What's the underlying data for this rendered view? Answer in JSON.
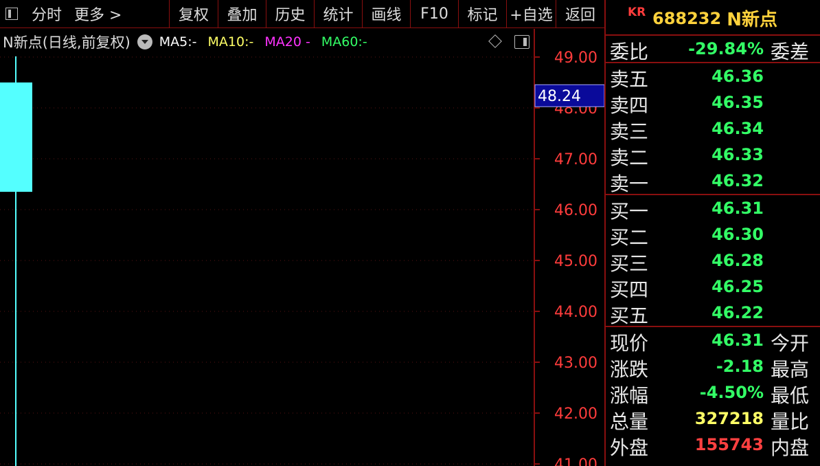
{
  "toolbar": {
    "text_items": [
      "分时",
      "更多 >"
    ],
    "buttons": [
      "复权",
      "叠加",
      "历史",
      "统计",
      "画线",
      "F10",
      "标记",
      "+自选",
      "返回"
    ]
  },
  "chart_header": {
    "title": "N新点(日线,前复权)",
    "ma": [
      {
        "label": "MA5:",
        "value": "-",
        "color": "#ffffff"
      },
      {
        "label": "MA10:",
        "value": "-",
        "color": "#ffff66"
      },
      {
        "label": "MA20",
        "value": "-",
        "color": "#ff33ff"
      },
      {
        "label": "MA60:",
        "value": "-",
        "color": "#33ff66"
      }
    ]
  },
  "chart_data": {
    "type": "candlestick",
    "ylim": [
      41,
      49.8
    ],
    "ticks": [
      "49.00",
      "48.00",
      "47.00",
      "46.00",
      "45.00",
      "44.00",
      "43.00",
      "42.00",
      "41.00"
    ],
    "tick_values": [
      49,
      48,
      47,
      46,
      45,
      44,
      43,
      42,
      41
    ],
    "current_price_label": "48.24",
    "current_price": 48.24,
    "candle": {
      "open": 48.5,
      "close": 46.35,
      "high": 50,
      "low": 41
    },
    "colors": {
      "candle_down": "#54ffff",
      "axis": "#8a0f0f",
      "tick_text": "#ff3c3c",
      "grid": "#5a1515"
    }
  },
  "quote": {
    "badge": "KR",
    "code": "688232",
    "name": "N新点",
    "ratio": {
      "label": "委比",
      "value": "-29.84%",
      "right": "委差"
    },
    "sell": [
      {
        "label": "卖五",
        "value": "46.36"
      },
      {
        "label": "卖四",
        "value": "46.35"
      },
      {
        "label": "卖三",
        "value": "46.34"
      },
      {
        "label": "卖二",
        "value": "46.33"
      },
      {
        "label": "卖一",
        "value": "46.32"
      }
    ],
    "buy": [
      {
        "label": "买一",
        "value": "46.31"
      },
      {
        "label": "买二",
        "value": "46.30"
      },
      {
        "label": "买三",
        "value": "46.28"
      },
      {
        "label": "买四",
        "value": "46.25"
      },
      {
        "label": "买五",
        "value": "46.22"
      }
    ],
    "stats": [
      {
        "label": "现价",
        "value": "46.31",
        "right": "今开",
        "color": "#33ff66"
      },
      {
        "label": "涨跌",
        "value": "-2.18",
        "right": "最高",
        "color": "#33ff66"
      },
      {
        "label": "涨幅",
        "value": "-4.50%",
        "right": "最低",
        "color": "#33ff66"
      },
      {
        "label": "总量",
        "value": "327218",
        "right": "量比",
        "color": "#ffff66"
      },
      {
        "label": "外盘",
        "value": "155743",
        "right": "内盘",
        "color": "#ff4040"
      }
    ],
    "colors": {
      "green": "#33ff66"
    }
  }
}
